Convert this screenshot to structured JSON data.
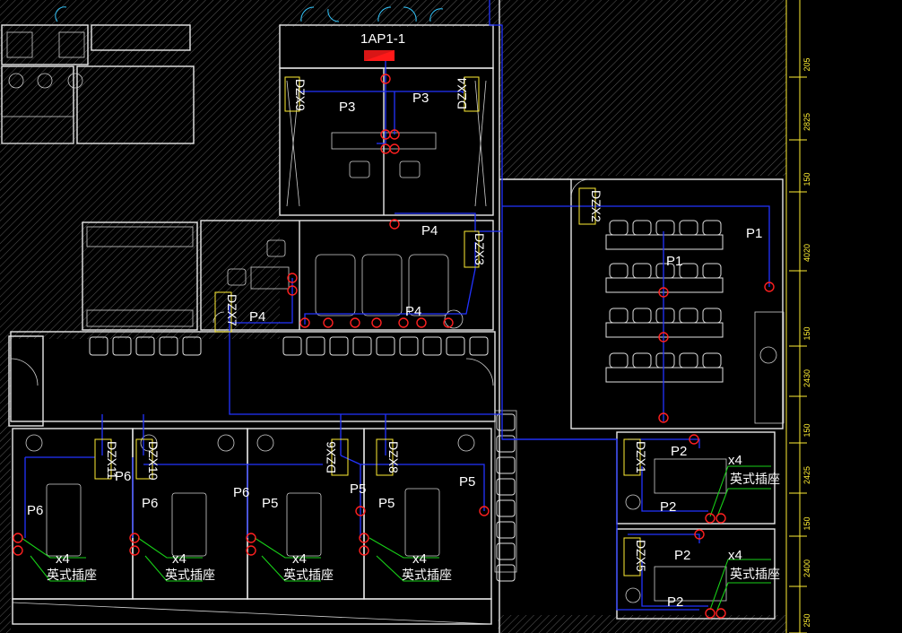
{
  "colors": {
    "background": "#000000",
    "wall": "#e8e8e8",
    "circuit": "#2233ff",
    "socket": "#ff2020",
    "box": "#ffee33",
    "lead": "#18d018",
    "door": "#33c8ff"
  },
  "main_panel": {
    "label": "1AP1-1"
  },
  "panels": [
    {
      "id": "9",
      "label": "DZX9"
    },
    {
      "id": "4",
      "label": "DZX4"
    },
    {
      "id": "3",
      "label": "DZX3"
    },
    {
      "id": "2",
      "label": "DZX2"
    },
    {
      "id": "7",
      "label": "DZX7"
    },
    {
      "id": "11",
      "label": "DZX11"
    },
    {
      "id": "10",
      "label": "DZX10"
    },
    {
      "id": "6",
      "label": "DZX6"
    },
    {
      "id": "8",
      "label": "DZX8"
    },
    {
      "id": "1",
      "label": "DZX1"
    },
    {
      "id": "5",
      "label": "DZX5"
    }
  ],
  "circuits": {
    "p1": "P1",
    "p2": "P2",
    "p3": "P3",
    "p4": "P4",
    "p5": "P5",
    "p6": "P6"
  },
  "socket_note": {
    "count": "x4",
    "type": "英式插座"
  },
  "dimensions": [
    "205",
    "2825",
    "150",
    "4020",
    "150",
    "2430",
    "150",
    "2425",
    "150",
    "2400",
    "250"
  ]
}
